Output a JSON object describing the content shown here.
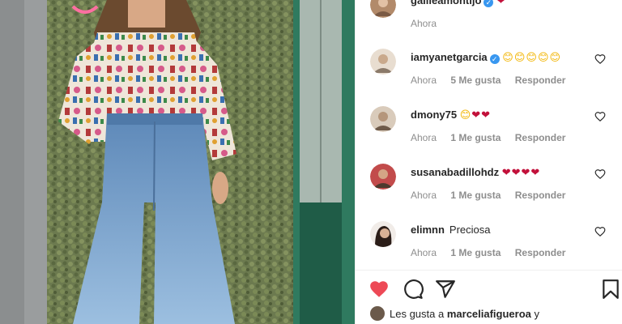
{
  "post": {
    "photo_alt": ""
  },
  "comments": [
    {
      "username": "galileamontijo",
      "verified": true,
      "text": "",
      "hearts": "❤",
      "emoji": "",
      "time": "Ahora",
      "likes": "",
      "reply": "",
      "avatar_color": "#b28a6a"
    },
    {
      "username": "iamyanetgarcia",
      "verified": true,
      "text": "",
      "emoji": "😊😊😊😊😊",
      "hearts": "",
      "time": "Ahora",
      "likes": "5 Me gusta",
      "reply": "Responder",
      "avatar_color": "#c9b7a4"
    },
    {
      "username": "dmony75",
      "verified": false,
      "text": "",
      "emoji": "😊",
      "hearts": "❤❤",
      "time": "Ahora",
      "likes": "1 Me gusta",
      "reply": "Responder",
      "avatar_color": "#a8927c"
    },
    {
      "username": "susanabadillohdz",
      "verified": false,
      "text": "",
      "emoji": "",
      "hearts": "❤❤❤❤",
      "time": "Ahora",
      "likes": "1 Me gusta",
      "reply": "Responder",
      "avatar_color": "#8a6b52"
    },
    {
      "username": "elimnn",
      "verified": false,
      "text": "Preciosa",
      "emoji": "",
      "hearts": "",
      "time": "Ahora",
      "likes": "1 Me gusta",
      "reply": "Responder",
      "avatar_color": "#3b2a24"
    }
  ],
  "actions": {
    "like_icon": "heart-filled-icon",
    "comment_icon": "comment-icon",
    "share_icon": "paper-plane-icon",
    "save_icon": "bookmark-icon",
    "like_color": "#ed4956"
  },
  "likes_summary": {
    "prefix": "Les gusta a",
    "user": "marceliafigueroa",
    "suffix": "y"
  },
  "colors": {
    "meta_gray": "#8e8e8e",
    "verified_blue": "#3897f0",
    "heart_red": "#ed4956"
  }
}
